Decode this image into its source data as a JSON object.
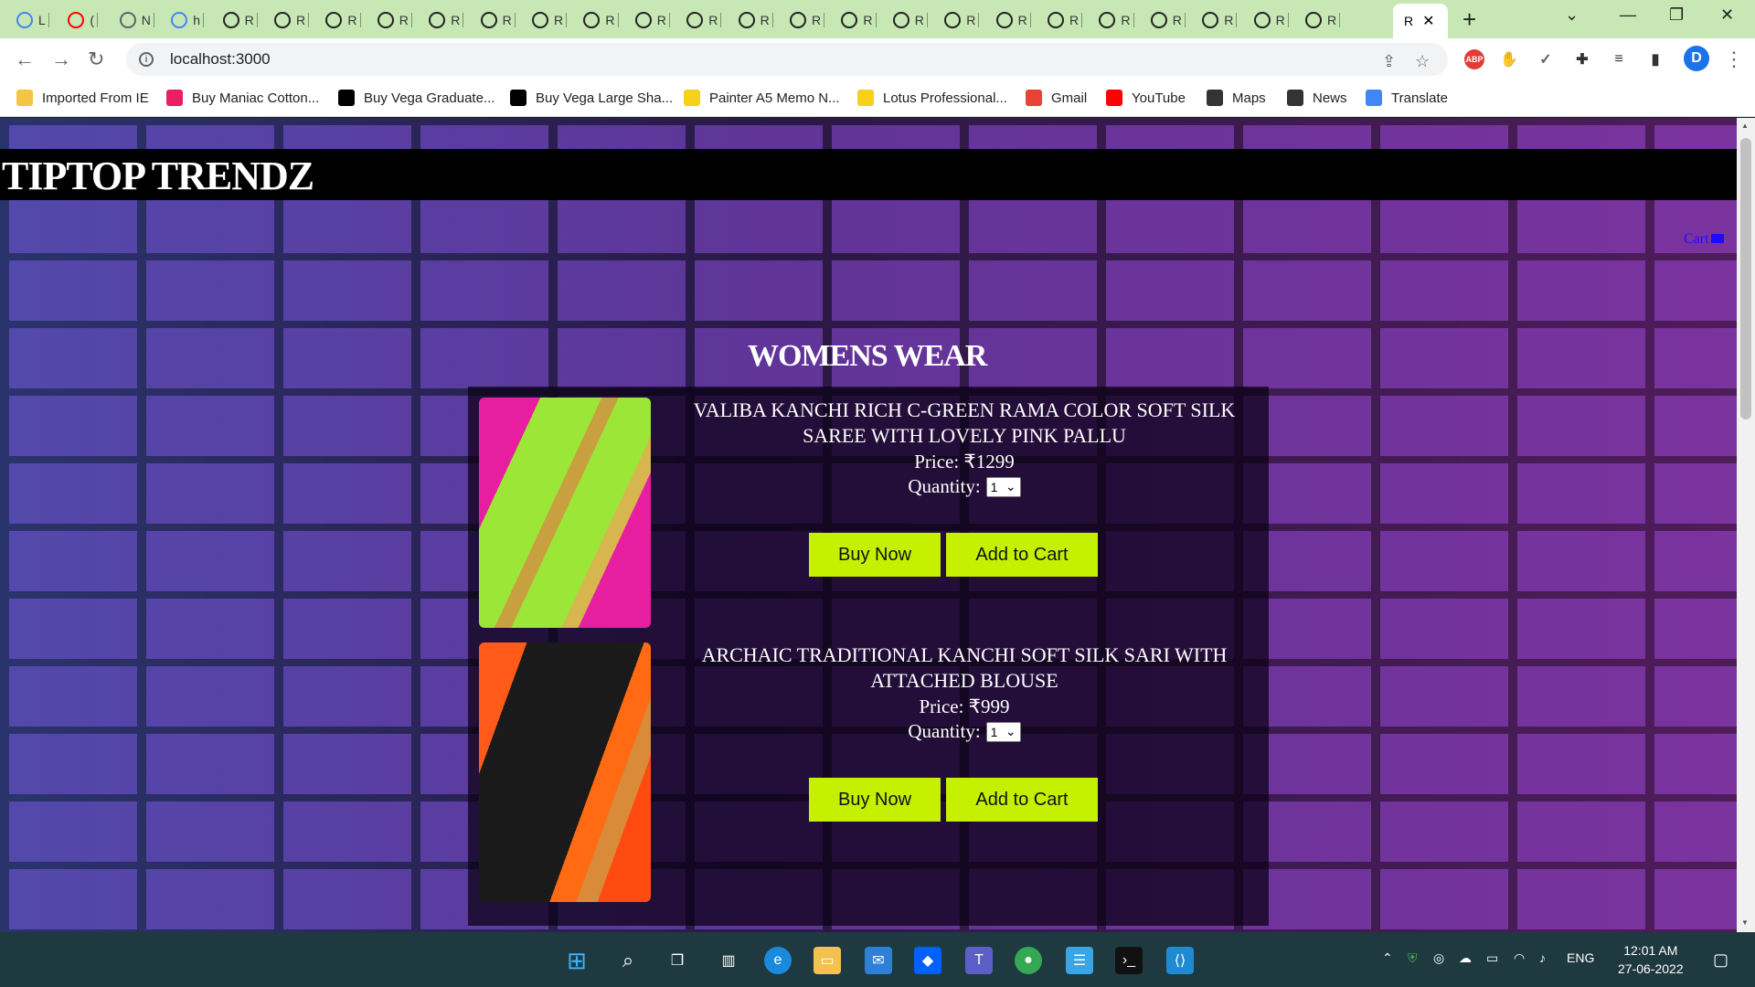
{
  "browser": {
    "tabs": [
      {
        "label": "L",
        "color": "#4285f4"
      },
      {
        "label": "(",
        "color": "#ff0000"
      },
      {
        "label": "N",
        "color": "#5f6368"
      },
      {
        "label": "h",
        "color": "#4285f4"
      },
      {
        "label": "R",
        "color": "#222"
      },
      {
        "label": "R",
        "color": "#222"
      },
      {
        "label": "R",
        "color": "#222"
      },
      {
        "label": "R",
        "color": "#222"
      },
      {
        "label": "R",
        "color": "#222"
      },
      {
        "label": "R",
        "color": "#222"
      },
      {
        "label": "R",
        "color": "#222"
      },
      {
        "label": "R",
        "color": "#222"
      },
      {
        "label": "R",
        "color": "#222"
      },
      {
        "label": "R",
        "color": "#222"
      },
      {
        "label": "R",
        "color": "#222"
      },
      {
        "label": "R",
        "color": "#222"
      },
      {
        "label": "R",
        "color": "#222"
      },
      {
        "label": "R",
        "color": "#222"
      },
      {
        "label": "R",
        "color": "#222"
      },
      {
        "label": "R",
        "color": "#222"
      },
      {
        "label": "R",
        "color": "#222"
      },
      {
        "label": "R",
        "color": "#222"
      },
      {
        "label": "R",
        "color": "#222"
      },
      {
        "label": "R",
        "color": "#222"
      },
      {
        "label": "R",
        "color": "#222"
      },
      {
        "label": "R",
        "color": "#222"
      }
    ],
    "active_tab": "R",
    "url": "localhost:3000",
    "profile_initial": "D",
    "bookmarks": [
      {
        "label": "Imported From IE",
        "icon": "folder-icon",
        "color": "#f4c542"
      },
      {
        "label": "Buy Maniac Cotton...",
        "icon": "shop-icon",
        "color": "#e91e63"
      },
      {
        "label": "Buy Vega Graduate...",
        "icon": "amazon-icon",
        "color": "#000"
      },
      {
        "label": "Buy Vega Large Sha...",
        "icon": "amazon-icon",
        "color": "#000"
      },
      {
        "label": "Painter A5 Memo N...",
        "icon": "flipkart-icon",
        "color": "#f7d117"
      },
      {
        "label": "Lotus Professional...",
        "icon": "flipkart-icon",
        "color": "#f7d117"
      },
      {
        "label": "Gmail",
        "icon": "gmail-icon",
        "color": "#ea4335"
      },
      {
        "label": "YouTube",
        "icon": "youtube-icon",
        "color": "#ff0000"
      },
      {
        "label": "Maps",
        "icon": "globe-icon",
        "color": "#333"
      },
      {
        "label": "News",
        "icon": "globe-icon",
        "color": "#333"
      },
      {
        "label": "Translate",
        "icon": "translate-icon",
        "color": "#4285f4"
      }
    ]
  },
  "site": {
    "brand": "TIPTOP TRENDZ",
    "cart_label": "Cart",
    "section_title": "WOMENS WEAR",
    "buy_label": "Buy Now",
    "add_label": "Add to Cart",
    "products": [
      {
        "name": "VALIBA KANCHI RICH C-GREEN RAMA COLOR SOFT SILK SAREE WITH LOVELY PINK PALLU",
        "price": "Price: ₹1299",
        "qty_label": "Quantity:",
        "qty_value": "1"
      },
      {
        "name": "ARCHAIC TRADITIONAL KANCHI SOFT SILK SARI WITH ATTACHED BLOUSE",
        "price": "Price: ₹999",
        "qty_label": "Quantity:",
        "qty_value": "1"
      }
    ]
  },
  "taskbar": {
    "lang": "ENG",
    "time": "12:01 AM",
    "date": "27-06-2022"
  }
}
